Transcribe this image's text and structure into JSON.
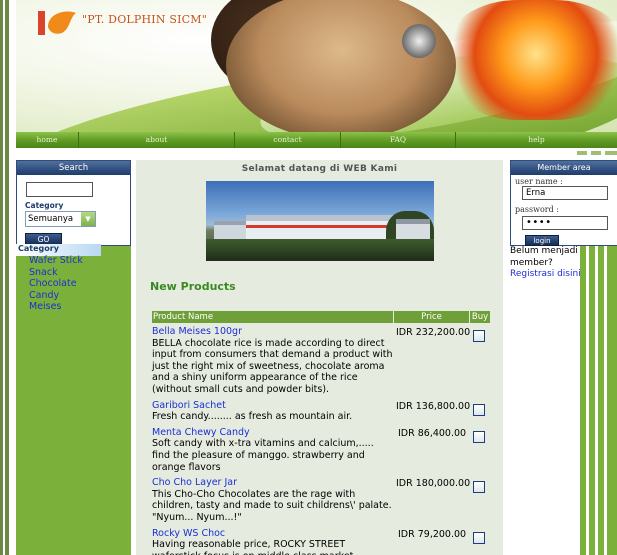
{
  "header": {
    "logo_text": "\"PT. DOLPHIN SICM\""
  },
  "nav": {
    "items": [
      "home",
      "about",
      "contact",
      "FAQ",
      "help"
    ]
  },
  "search": {
    "title": "Search",
    "input_value": "",
    "category_label": "Category",
    "category_selected": "Semuanya",
    "go_label": "GO"
  },
  "categories": {
    "title": "Category",
    "items": [
      "Wafer Stick",
      "Snack",
      "Chocolate",
      "Candy",
      "Meises"
    ]
  },
  "main": {
    "welcome": "Selamat datang di WEB Kami",
    "section_title": "New Products",
    "columns": [
      "Product Name",
      "Price",
      "Buy"
    ],
    "products": [
      {
        "name": "Bella Meises 100gr",
        "description": "BELLA chocolate rice is made according to direct input from consumers that demand a product with just the right mix of sweetness, chocolate aroma and a shiny uniform appearance of the rice (without small cuts and powder bits).",
        "price": "IDR 232,200.00"
      },
      {
        "name": "Garibori Sachet",
        "description": "Fresh candy........ as fresh as mountain air.",
        "price": "IDR 136,800.00"
      },
      {
        "name": "Menta Chewy Candy",
        "description": "Soft candy with x-tra vitamins and calcium,..... find the pleasure of manggo. strawberry and orange flavors",
        "price": "IDR 86,400.00"
      },
      {
        "name": "Cho Cho Layer Jar",
        "description": "This Cho-Cho Chocolates are the rage with children, tasty and made to suit childrens\\' palate. \"Nyum... Nyum...!\"",
        "price": "IDR 180,000.00"
      },
      {
        "name": "Rocky WS Choc",
        "description": "Having reasonable price, ROCKY STREET waferstick focus is on middle class market.",
        "price": "IDR 79,200.00"
      }
    ]
  },
  "member": {
    "title": "Member area",
    "user_label": "user name :",
    "user_value": "Erna",
    "password_label": "password :",
    "password_value": "••••",
    "login_label": "login",
    "register_text": "Belum menjadi member?",
    "register_link": "Registrasi disini"
  },
  "colors": {
    "green": "#7bb13a",
    "navy": "#1f3c6a",
    "link": "#1a2fd6",
    "logo_orange": "#c5531c"
  }
}
